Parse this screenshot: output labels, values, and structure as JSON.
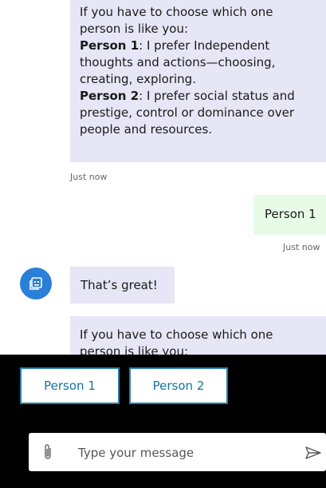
{
  "messages": {
    "bot1": {
      "intro": "If you have to choose which one person is like you:",
      "p1_label": "Person 1",
      "p1_text": ": I prefer Independent thoughts and actions—choosing, creating, exploring.",
      "p2_label": "Person 2",
      "p2_text": ": I prefer social status and prestige, control or dominance over people and resources.",
      "timestamp": "Just now"
    },
    "user1": {
      "text": "Person 1",
      "timestamp": "Just now"
    },
    "bot2": {
      "text": "That’s great!"
    },
    "bot3": {
      "intro": "If you have to choose which one person is like you:"
    }
  },
  "suggestions": [
    "Person 1",
    "Person 2"
  ],
  "composer": {
    "placeholder": "Type your message"
  },
  "icons": {
    "avatar": "bot-icon",
    "attach": "paperclip-icon",
    "send": "send-icon"
  },
  "colors": {
    "bot_bubble": "#e6e6f7",
    "user_bubble": "#e8fbe7",
    "avatar": "#2a7fd8",
    "suggestion_border": "#2b7fa8"
  }
}
